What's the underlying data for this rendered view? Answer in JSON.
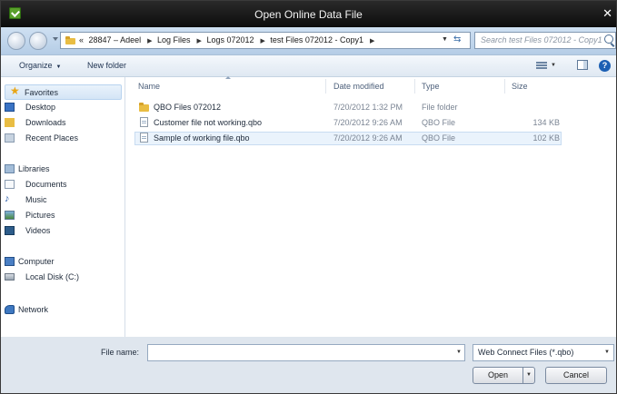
{
  "window": {
    "title": "Open Online Data File"
  },
  "address": {
    "crumbs": [
      "«",
      "28847 – Adeel",
      "Log Files",
      "Logs 072012",
      "test Files 072012 - Copy1"
    ],
    "search_placeholder": "Search test Files 072012 - Copy1"
  },
  "toolbar": {
    "organize_label": "Organize",
    "new_folder_label": "New folder"
  },
  "nav": {
    "favorites": "Favorites",
    "desktop": "Desktop",
    "downloads": "Downloads",
    "recent": "Recent Places",
    "libraries": "Libraries",
    "documents": "Documents",
    "music": "Music",
    "pictures": "Pictures",
    "videos": "Videos",
    "computer": "Computer",
    "local_disk": "Local Disk (C:)",
    "network": "Network"
  },
  "columns": {
    "name": "Name",
    "date": "Date modified",
    "type": "Type",
    "size": "Size"
  },
  "files": [
    {
      "name": "QBO Files 072012",
      "date": "7/20/2012 1:32 PM",
      "type": "File folder",
      "size": ""
    },
    {
      "name": "Customer file not working.qbo",
      "date": "7/20/2012 9:26 AM",
      "type": "QBO File",
      "size": "134 KB"
    },
    {
      "name": "Sample of working file.qbo",
      "date": "7/20/2012 9:26 AM",
      "type": "QBO File",
      "size": "102 KB"
    }
  ],
  "footer": {
    "file_name_label": "File name:",
    "file_name_value": "",
    "filter_value": "Web Connect Files (*.qbo)",
    "open_label": "Open",
    "cancel_label": "Cancel"
  }
}
